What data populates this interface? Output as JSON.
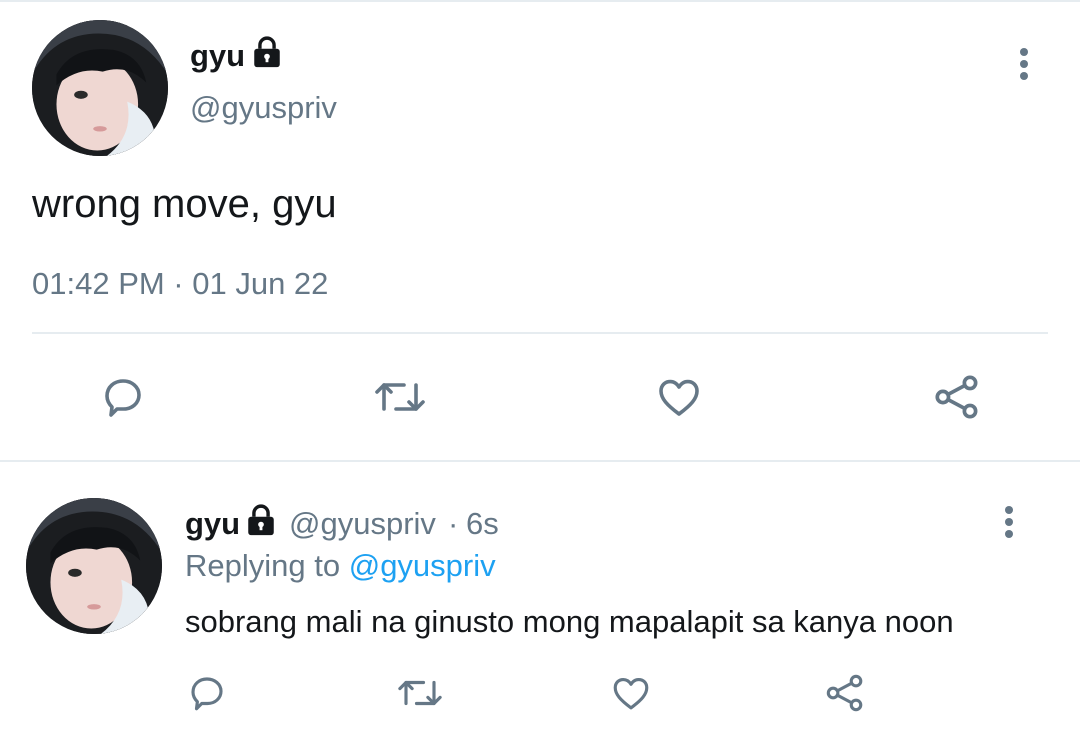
{
  "main_tweet": {
    "display_name": "gyu",
    "handle": "@gyuspriv",
    "text": "wrong move, gyu",
    "timestamp": "01:42 PM · 01 Jun 22",
    "icons": {
      "protected": "lock-icon",
      "menu": "more-vertical-icon",
      "actions": [
        "reply-icon",
        "retweet-icon",
        "like-icon",
        "share-icon"
      ]
    }
  },
  "reply_tweet": {
    "display_name": "gyu",
    "handle": "@gyuspriv",
    "separator": "·",
    "age": "6s",
    "replying_prefix": "Replying to",
    "replying_to": "@gyuspriv",
    "text": "sobrang mali na ginusto mong mapalapit sa kanya noon",
    "icons": {
      "protected": "lock-icon",
      "menu": "more-vertical-icon",
      "actions": [
        "reply-icon",
        "retweet-icon",
        "like-icon",
        "share-icon"
      ]
    }
  },
  "colors": {
    "text_primary": "#14171a",
    "text_secondary": "#657786",
    "link": "#1da1f2",
    "divider": "#e6ecf0"
  }
}
